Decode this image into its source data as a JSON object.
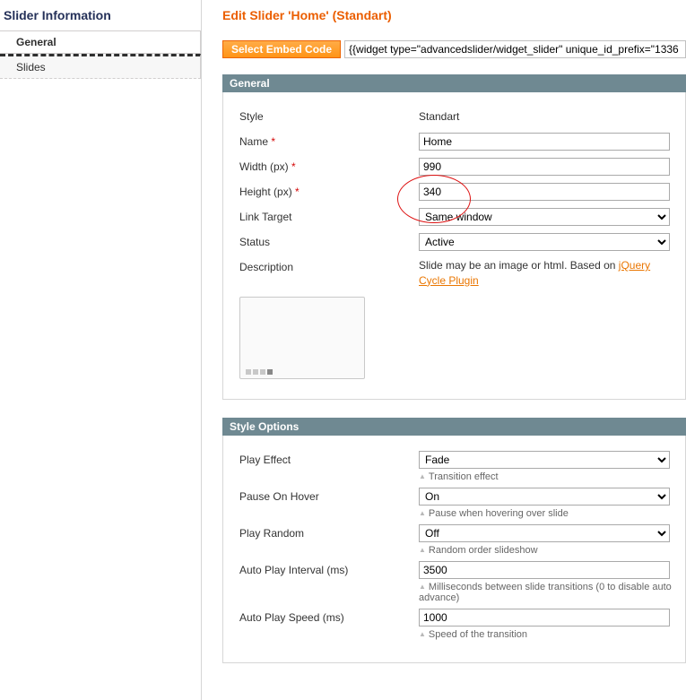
{
  "sidebar": {
    "title": "Slider Information",
    "items": [
      {
        "label": "General"
      },
      {
        "label": "Slides"
      }
    ]
  },
  "page": {
    "title": "Edit Slider 'Home' (Standart)"
  },
  "embed": {
    "button": "Select Embed Code",
    "code": "{{widget type=\"advancedslider/widget_slider\" unique_id_prefix=\"1336"
  },
  "general": {
    "heading": "General",
    "style_label": "Style",
    "style_value": "Standart",
    "name_label": "Name",
    "name_value": "Home",
    "width_label": "Width (px)",
    "width_value": "990",
    "height_label": "Height (px)",
    "height_value": "340",
    "link_target_label": "Link Target",
    "link_target_value": "Same window",
    "status_label": "Status",
    "status_value": "Active",
    "description_label": "Description",
    "description_prefix": "Slide may be an image or html. Based on ",
    "description_link": "jQuery Cycle Plugin"
  },
  "style_options": {
    "heading": "Style Options",
    "play_effect_label": "Play Effect",
    "play_effect_value": "Fade",
    "play_effect_note": "Transition effect",
    "pause_hover_label": "Pause On Hover",
    "pause_hover_value": "On",
    "pause_hover_note": "Pause when hovering over slide",
    "play_random_label": "Play Random",
    "play_random_value": "Off",
    "play_random_note": "Random order slideshow",
    "autoplay_interval_label": "Auto Play Interval (ms)",
    "autoplay_interval_value": "3500",
    "autoplay_interval_note": "Milliseconds between slide transitions (0 to disable auto advance)",
    "autoplay_speed_label": "Auto Play Speed (ms)",
    "autoplay_speed_value": "1000",
    "autoplay_speed_note": "Speed of the transition"
  }
}
